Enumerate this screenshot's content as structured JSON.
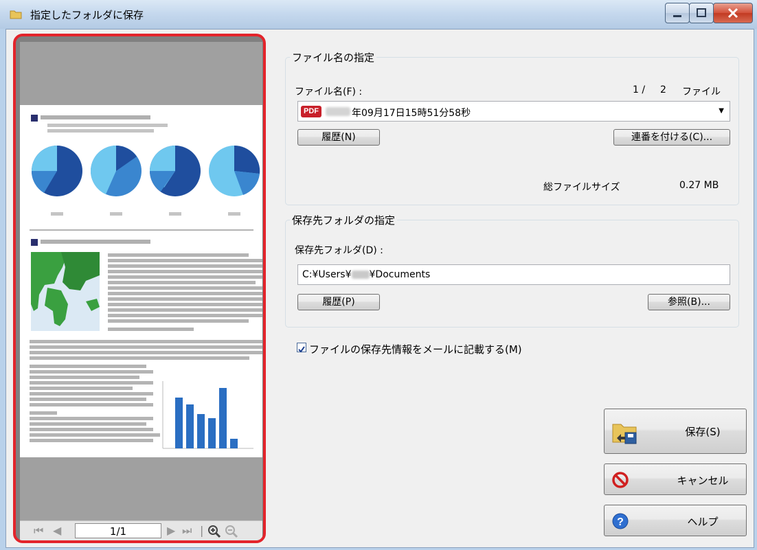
{
  "window": {
    "title": "指定したフォルダに保存"
  },
  "file_name": {
    "group_title": "ファイル名の指定",
    "label": "ファイル名(F) :",
    "count_current": "1 /",
    "count_total": "2",
    "count_unit": "ファイル",
    "pdf_badge": "PDF",
    "value": "年09月17日15時51分58秒",
    "history_button": "履歴(N)",
    "serial_button": "連番を付ける(C)...",
    "total_size_label": "総ファイルサイズ",
    "total_size_value": "0.27 MB"
  },
  "folder": {
    "group_title": "保存先フォルダの指定",
    "label": "保存先フォルダ(D) :",
    "path_prefix": "C:¥Users¥",
    "path_suffix": "¥Documents",
    "history_button": "履歴(P)",
    "browse_button": "参照(B)..."
  },
  "mail_option": {
    "label": "ファイルの保存先情報をメールに記載する(M)",
    "checked": true
  },
  "actions": {
    "save": "保存(S)",
    "cancel": "キャンセル",
    "help": "ヘルプ"
  },
  "preview": {
    "page_indicator": "1/1"
  },
  "colors": {
    "highlight": "#e3242b",
    "pdf_badge": "#c8202a",
    "chart_blue": "#2a6ec2"
  }
}
